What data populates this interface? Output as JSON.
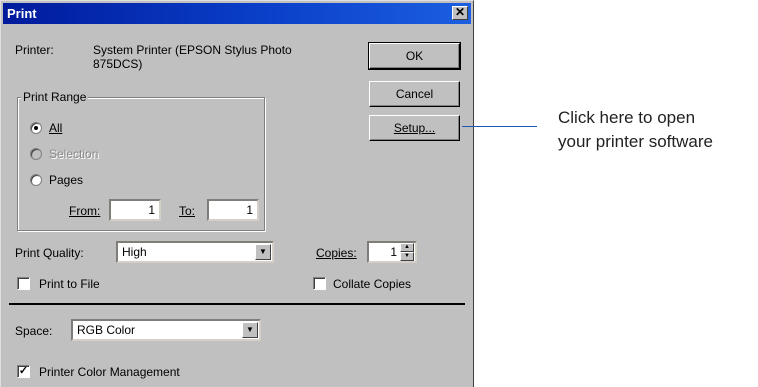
{
  "dialog": {
    "title": "Print",
    "close_glyph": "✕",
    "printer_label": "Printer:",
    "printer_name": "System Printer (EPSON Stylus Photo 875DCS)",
    "buttons": {
      "ok": "OK",
      "cancel": "Cancel",
      "setup": "Setup..."
    },
    "print_range": {
      "title": "Print Range",
      "all": "All",
      "selection": "Selection",
      "pages": "Pages",
      "selected": "all",
      "from_label": "From:",
      "from_value": "1",
      "to_label": "To:",
      "to_value": "1"
    },
    "print_quality": {
      "label": "Print Quality:",
      "value": "High"
    },
    "copies": {
      "label": "Copies:",
      "value": "1"
    },
    "print_to_file": {
      "label": "Print to File",
      "checked": false
    },
    "collate": {
      "label": "Collate Copies",
      "checked": false
    },
    "space": {
      "label": "Space:",
      "value": "RGB Color"
    },
    "color_management": {
      "label": "Printer Color Management",
      "checked": true
    },
    "check_glyph": "✓",
    "dropdown_glyph": "▼",
    "spin_up_glyph": "▲",
    "spin_down_glyph": "▼"
  },
  "callout": {
    "line1": "Click here to open",
    "line2": "your printer software"
  }
}
